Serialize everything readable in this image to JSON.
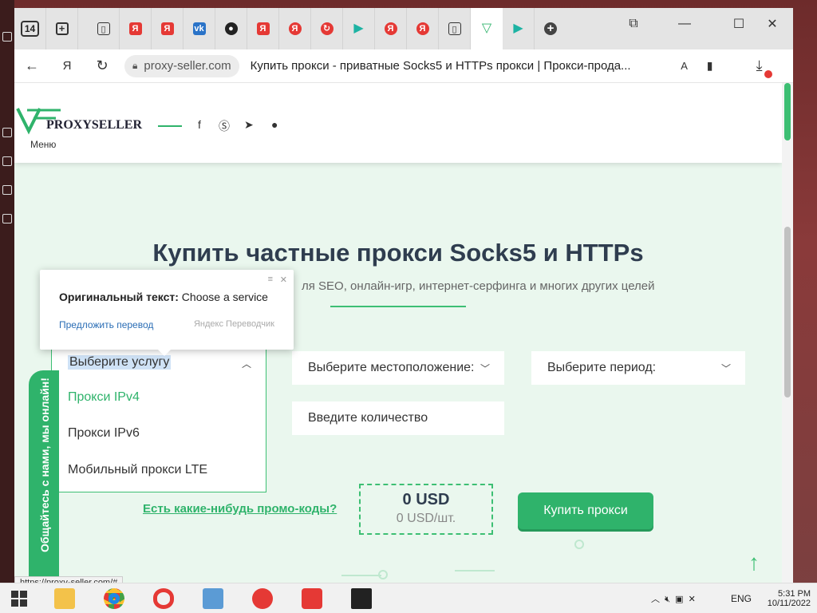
{
  "browser": {
    "tab_count": "14",
    "url": "proxy-seller.com",
    "page_title": "Купить прокси - приватные Socks5 и HTTPs прокси | Прокси-прода..."
  },
  "site": {
    "logo": "PROXYSELLER",
    "menu_label": "Меню",
    "headline": "Купить частные прокси Socks5 и HTTPs",
    "subtitle": "ля SEO, онлайн-игр, интернет-серфинга и многих других целей"
  },
  "translator_popup": {
    "original_label": "Оригинальный текст:",
    "original_text": "Choose a service",
    "suggest_link": "Предложить перевод",
    "brand": "Яндекс Переводчик"
  },
  "service_dropdown": {
    "placeholder": "Выберите услугу",
    "options": [
      "Прокси IPv4",
      "Прокси IPv6",
      "Мобильный прокси LTE"
    ]
  },
  "location_select": "Выберите местоположение:",
  "period_select": "Выберите период:",
  "quantity_input": "Введите количество",
  "chat_tab": "Общайтесь с нами, мы онлайн!",
  "promo_link": "Есть какие-нибудь промо-коды?",
  "price": {
    "total": "0 USD",
    "per_unit": "0 USD/шт."
  },
  "buy_button": "Купить прокси",
  "status_url": "https://proxy-seller.com/#",
  "taskbar": {
    "language": "ENG",
    "time": "5:31 PM",
    "date": "10/11/2022"
  },
  "colors": {
    "accent": "#2fb36b",
    "page_bg": "#eaf7ee",
    "heading": "#2f3d4f"
  }
}
